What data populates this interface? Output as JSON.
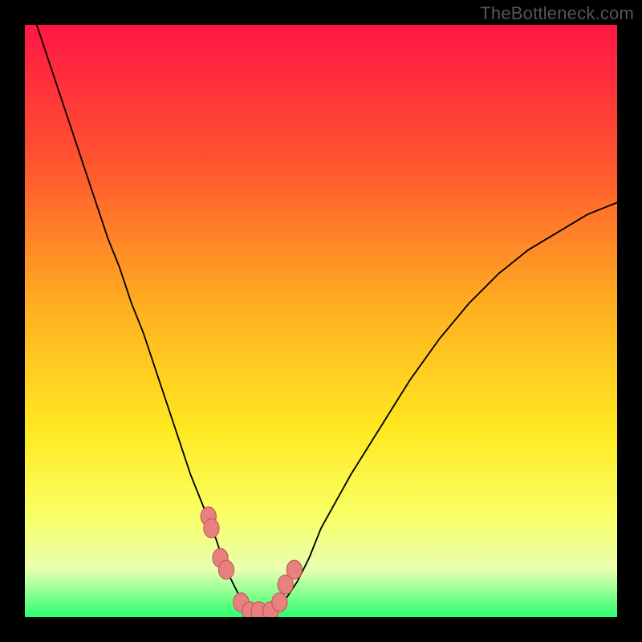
{
  "watermark": "TheBottleneck.com",
  "colors": {
    "frame": "#000000",
    "gradient_top": "#ff1744",
    "gradient_mid1": "#ff5030",
    "gradient_mid2": "#ffb020",
    "gradient_mid3": "#ffe820",
    "gradient_mid4": "#faff60",
    "gradient_mid5": "#e8ffb0",
    "gradient_bottom": "#2bff70",
    "curve": "#000000",
    "knob_fill": "#e88080",
    "knob_stroke": "#c05858"
  },
  "chart_data": {
    "type": "line",
    "title": "",
    "xlabel": "",
    "ylabel": "",
    "xlim": [
      0,
      100
    ],
    "ylim": [
      0,
      100
    ],
    "x": [
      0,
      2,
      4,
      6,
      8,
      10,
      12,
      14,
      16,
      18,
      20,
      22,
      24,
      26,
      28,
      30,
      32,
      34,
      36,
      37,
      38,
      39,
      40,
      42,
      44,
      46,
      48,
      50,
      55,
      60,
      65,
      70,
      75,
      80,
      85,
      90,
      95,
      100
    ],
    "values": [
      105,
      100,
      94,
      88,
      82,
      76,
      70,
      64,
      59,
      53,
      48,
      42,
      36,
      30,
      24,
      19,
      14,
      8,
      4,
      2,
      1,
      1,
      1,
      1,
      3,
      6,
      10,
      15,
      24,
      32,
      40,
      47,
      53,
      58,
      62,
      65,
      68,
      70
    ],
    "knobs": {
      "x": [
        31.0,
        31.5,
        33.0,
        34.0,
        36.5,
        38.0,
        39.5,
        41.5,
        43.0,
        44.0,
        45.5
      ],
      "y": [
        17.0,
        15.0,
        10.0,
        8.0,
        2.5,
        1.0,
        1.0,
        1.0,
        2.5,
        5.5,
        8.0
      ]
    }
  }
}
